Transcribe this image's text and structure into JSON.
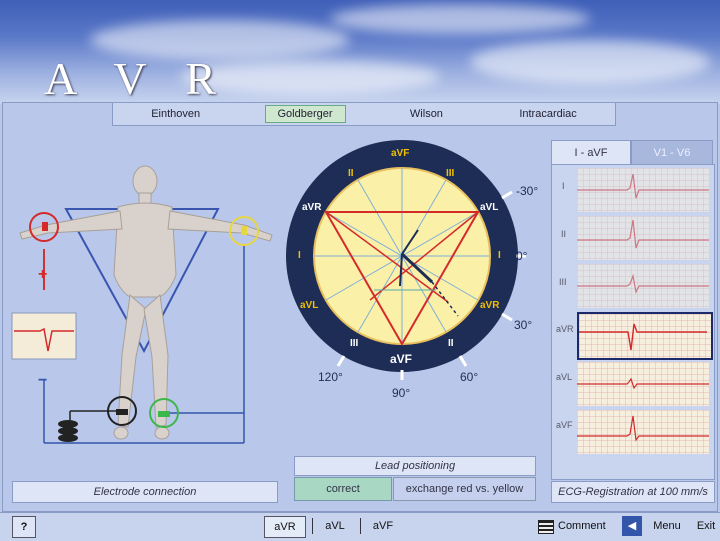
{
  "header": {
    "title": "A V R"
  },
  "tabs": [
    {
      "label": "Einthoven",
      "active": false
    },
    {
      "label": "Goldberger",
      "active": true
    },
    {
      "label": "Wilson",
      "active": false
    },
    {
      "label": "Intracardiac",
      "active": false
    }
  ],
  "electrode": {
    "label": "Electrode connection",
    "plus": "+",
    "minus": "−"
  },
  "circle": {
    "top_label": "aVF",
    "bottom_label": "aVF",
    "left_upper": "aVR",
    "right_upper": "aVL",
    "left_mid": "I",
    "right_mid": "I",
    "left_lower": "aVL",
    "right_lower": "aVR",
    "upper_left_III": "III",
    "upper_II": "II",
    "upper_right_III": "III",
    "bottom_left_III": "III",
    "bottom_right_II": "II",
    "left_II": "II",
    "deg_m30": "-30°",
    "deg_0": "0°",
    "deg_30": "30°",
    "deg_60": "60°",
    "deg_90": "90°",
    "deg_120": "120°"
  },
  "lead_positioning": {
    "title": "Lead positioning",
    "correct": "correct",
    "exchange": "exchange red vs. yellow"
  },
  "ecg": {
    "tab_active": "I - aVF",
    "tab_inactive": "V1 - V6",
    "leads": [
      "I",
      "II",
      "III",
      "aVR",
      "aVL",
      "aVF"
    ],
    "selected_lead": "aVR",
    "footer": "ECG-Registration at 100 mm/s"
  },
  "bottom": {
    "help": "?",
    "lead_aVR": "aVR",
    "lead_aVL": "aVL",
    "lead_aVF": "aVF",
    "comment": "Comment",
    "menu": "Menu",
    "exit": "Exit"
  },
  "colors": {
    "accent_red": "#d42a2a",
    "accent_yellow": "#e8d640",
    "accent_green": "#3cb84a",
    "dial_navy": "#1e2d55"
  }
}
